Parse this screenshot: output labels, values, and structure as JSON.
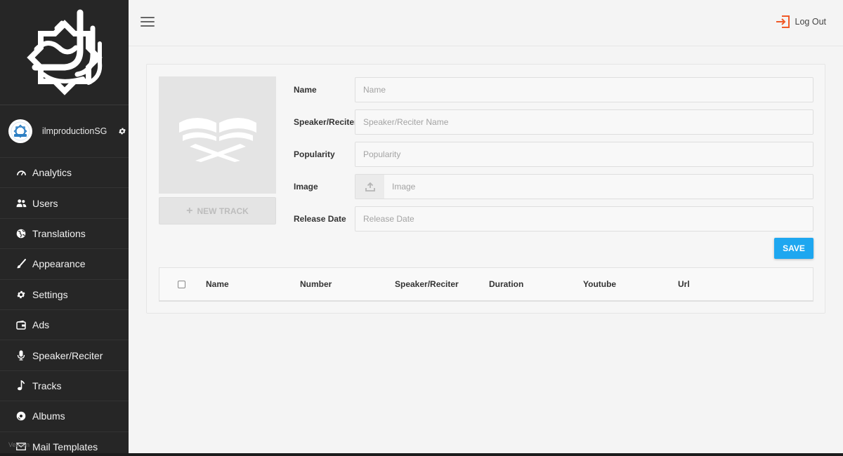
{
  "user": {
    "name": "ilmproductionSG"
  },
  "nav": [
    {
      "label": "Analytics",
      "icon": "speedometer-icon"
    },
    {
      "label": "Users",
      "icon": "users-icon"
    },
    {
      "label": "Translations",
      "icon": "globe-icon"
    },
    {
      "label": "Appearance",
      "icon": "brush-icon"
    },
    {
      "label": "Settings",
      "icon": "gear-icon"
    },
    {
      "label": "Ads",
      "icon": "wallet-icon"
    },
    {
      "label": "Speaker/Reciter",
      "icon": "microphone-icon"
    },
    {
      "label": "Tracks",
      "icon": "music-note-icon"
    },
    {
      "label": "Albums",
      "icon": "disc-icon"
    },
    {
      "label": "Mail Templates",
      "icon": "envelope-icon"
    }
  ],
  "version": "Version",
  "topbar": {
    "logout_label": "Log Out"
  },
  "form": {
    "new_track_label": "NEW TRACK",
    "fields": {
      "name": {
        "label": "Name",
        "placeholder": "Name",
        "value": ""
      },
      "speaker": {
        "label": "Speaker/Reciter",
        "placeholder": "Speaker/Reciter Name",
        "value": ""
      },
      "popularity": {
        "label": "Popularity",
        "placeholder": "Popularity",
        "value": ""
      },
      "image": {
        "label": "Image",
        "placeholder": "Image",
        "value": ""
      },
      "release_date": {
        "label": "Release Date",
        "placeholder": "Release Date",
        "value": ""
      }
    },
    "save_label": "SAVE"
  },
  "table": {
    "columns": [
      "Name",
      "Number",
      "Speaker/Reciter",
      "Duration",
      "Youtube",
      "Url"
    ],
    "rows": []
  },
  "colors": {
    "sidebar_bg": "#262626",
    "accent_blue": "#1ea7f0",
    "logout_orange": "#f05a28"
  }
}
